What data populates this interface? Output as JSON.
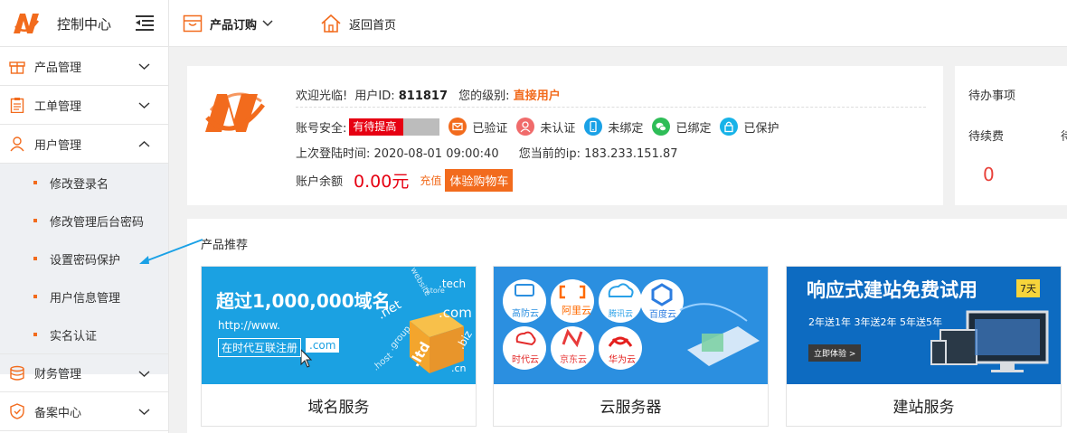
{
  "app": {
    "title": "控制中心"
  },
  "topnav": {
    "orders": "产品订购",
    "home": "返回首页"
  },
  "sidebar": {
    "items": [
      {
        "label": "产品管理"
      },
      {
        "label": "工单管理"
      },
      {
        "label": "用户管理"
      },
      {
        "label": "财务管理"
      },
      {
        "label": "备案中心"
      }
    ],
    "sub_items": [
      {
        "label": "修改登录名"
      },
      {
        "label": "修改管理后台密码"
      },
      {
        "label": "设置密码保护"
      },
      {
        "label": "用户信息管理"
      },
      {
        "label": "实名认证"
      }
    ]
  },
  "welcome": {
    "greeting": "欢迎光临!",
    "uid_label": "用户ID:",
    "uid": "811817",
    "level_label": "您的级别:",
    "level": "直接用户",
    "security_label": "账号安全:",
    "security_badge": "有待提高",
    "security": [
      {
        "label": "已验证",
        "icon": "mail-icon",
        "color": "#f26b1d"
      },
      {
        "label": "未认证",
        "icon": "person-icon",
        "color": "#f06b6b"
      },
      {
        "label": "未绑定",
        "icon": "phone-icon",
        "color": "#1aa1e6"
      },
      {
        "label": "已绑定",
        "icon": "wechat-icon",
        "color": "#2ebd57"
      },
      {
        "label": "已保护",
        "icon": "lock-icon",
        "color": "#17b3e8"
      }
    ],
    "last_login_label": "上次登陆时间:",
    "last_login": "2020-08-01 09:00:40",
    "ip_label": "您当前的ip:",
    "ip": "183.233.151.87",
    "balance_label": "账户余额",
    "balance": "0.00元",
    "recharge": "充值",
    "try_cart": "体验购物车"
  },
  "todo": {
    "title": "待办事项",
    "renew_label": "待续费",
    "next_label": "待",
    "renew_count": "0"
  },
  "products": {
    "title": "产品推荐",
    "items": [
      {
        "name": "域名服务",
        "banner_headline": "超过1,000,000域名",
        "banner_url": "http://www.",
        "banner_box": "在时代互联注册",
        "banner_suffix": ".com",
        "tlds": [
          ".net",
          ".tech",
          ".com",
          ".biz",
          ".ltd",
          ".cn",
          ".host",
          "website",
          ".store",
          ".group"
        ]
      },
      {
        "name": "云服务器",
        "clouds": [
          "高防云",
          "阿里云",
          "腾讯云",
          "百度云",
          "时代云",
          "京东云",
          "华为云"
        ]
      },
      {
        "name": "建站服务",
        "banner_headline": "响应式建站免费试用",
        "banner_badge": "7天",
        "banner_sub": "2年送1年 3年送2年 5年送5年",
        "banner_button": "立即体验 >"
      }
    ]
  },
  "colors": {
    "accent": "#f26b1d",
    "danger": "#e60012",
    "domain_banner": "#1ba1e2",
    "cloud_banner": "#2b8fe0",
    "site_banner": "#0d6bc1"
  }
}
